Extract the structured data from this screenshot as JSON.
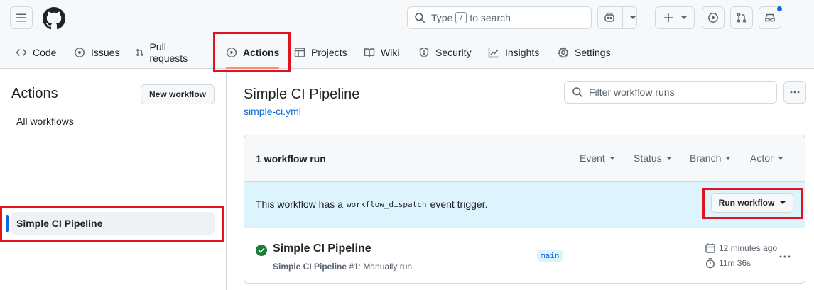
{
  "header": {
    "search_placeholder_prefix": "Type",
    "search_key": "/",
    "search_placeholder_suffix": "to search"
  },
  "tabs": [
    {
      "label": "Code",
      "icon": "code-icon"
    },
    {
      "label": "Issues",
      "icon": "issue-opened-icon"
    },
    {
      "label": "Pull requests",
      "icon": "pull-request-icon"
    },
    {
      "label": "Actions",
      "icon": "play-icon",
      "active": true
    },
    {
      "label": "Projects",
      "icon": "table-icon"
    },
    {
      "label": "Wiki",
      "icon": "book-icon"
    },
    {
      "label": "Security",
      "icon": "shield-icon"
    },
    {
      "label": "Insights",
      "icon": "graph-icon"
    },
    {
      "label": "Settings",
      "icon": "gear-icon"
    }
  ],
  "sidebar": {
    "title": "Actions",
    "new_workflow_label": "New workflow",
    "all_workflows_label": "All workflows",
    "selected_workflow": "Simple CI Pipeline"
  },
  "main": {
    "workflow_title": "Simple CI Pipeline",
    "workflow_file": "simple-ci.yml",
    "filter_placeholder": "Filter workflow runs",
    "run_count": "1 workflow run",
    "filters": [
      "Event",
      "Status",
      "Branch",
      "Actor"
    ],
    "dispatch_prefix": "This workflow has a",
    "dispatch_code": "workflow_dispatch",
    "dispatch_suffix": "event trigger.",
    "run_workflow_label": "Run workflow",
    "run": {
      "name": "Simple CI Pipeline",
      "meta_name": "Simple CI Pipeline",
      "meta_rest": "#1: Manually run",
      "branch": "main",
      "time_ago": "12 minutes ago",
      "duration": "11m 36s",
      "status": "success"
    }
  },
  "colors": {
    "accent": "#0969da",
    "success": "#1a7f37",
    "highlight": "#e0141e",
    "tab_underline": "#fd8c73"
  }
}
